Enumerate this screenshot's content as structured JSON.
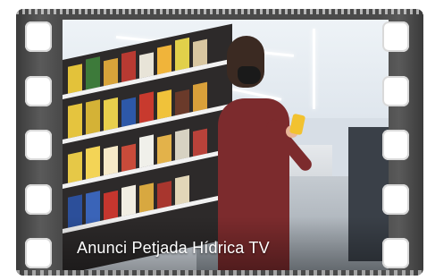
{
  "video": {
    "caption": "Anunci Petjada Hídrica TV",
    "thumbnail_icon": "film-strip-icon"
  },
  "colors": {
    "film_strip": "#4b4b4b",
    "sprocket_hole": "#ffffff",
    "caption_text": "#ffffff",
    "shirt": "#7c2b2d",
    "phone": "#f2c230"
  }
}
